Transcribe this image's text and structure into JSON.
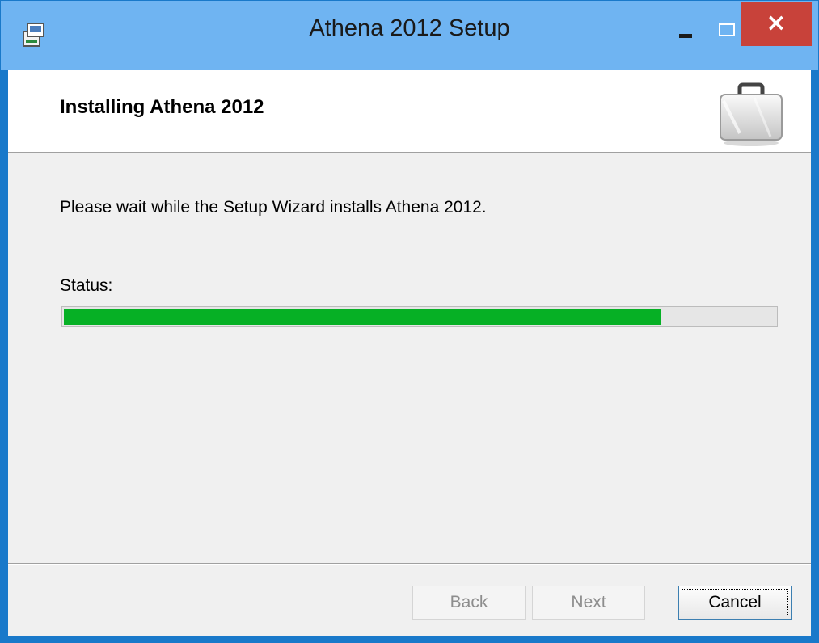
{
  "window": {
    "title": "Athena 2012 Setup",
    "icons": {
      "app": "installer-icon",
      "minimize": "minimize-icon",
      "maximize": "maximize-icon",
      "close": "close-icon"
    },
    "close_glyph": "×"
  },
  "banner": {
    "title": "Installing Athena 2012",
    "icon": "briefcase-icon"
  },
  "body": {
    "description": "Please wait while the Setup Wizard installs Athena 2012.",
    "status_label": "Status:",
    "progress": 0.84
  },
  "buttons": {
    "back": "Back",
    "next": "Next",
    "cancel": "Cancel"
  },
  "colors": {
    "accent_border": "#1979ca",
    "titlebar": "#6fb4f2",
    "close_button": "#c8423a",
    "progress_fill": "#06b025"
  }
}
